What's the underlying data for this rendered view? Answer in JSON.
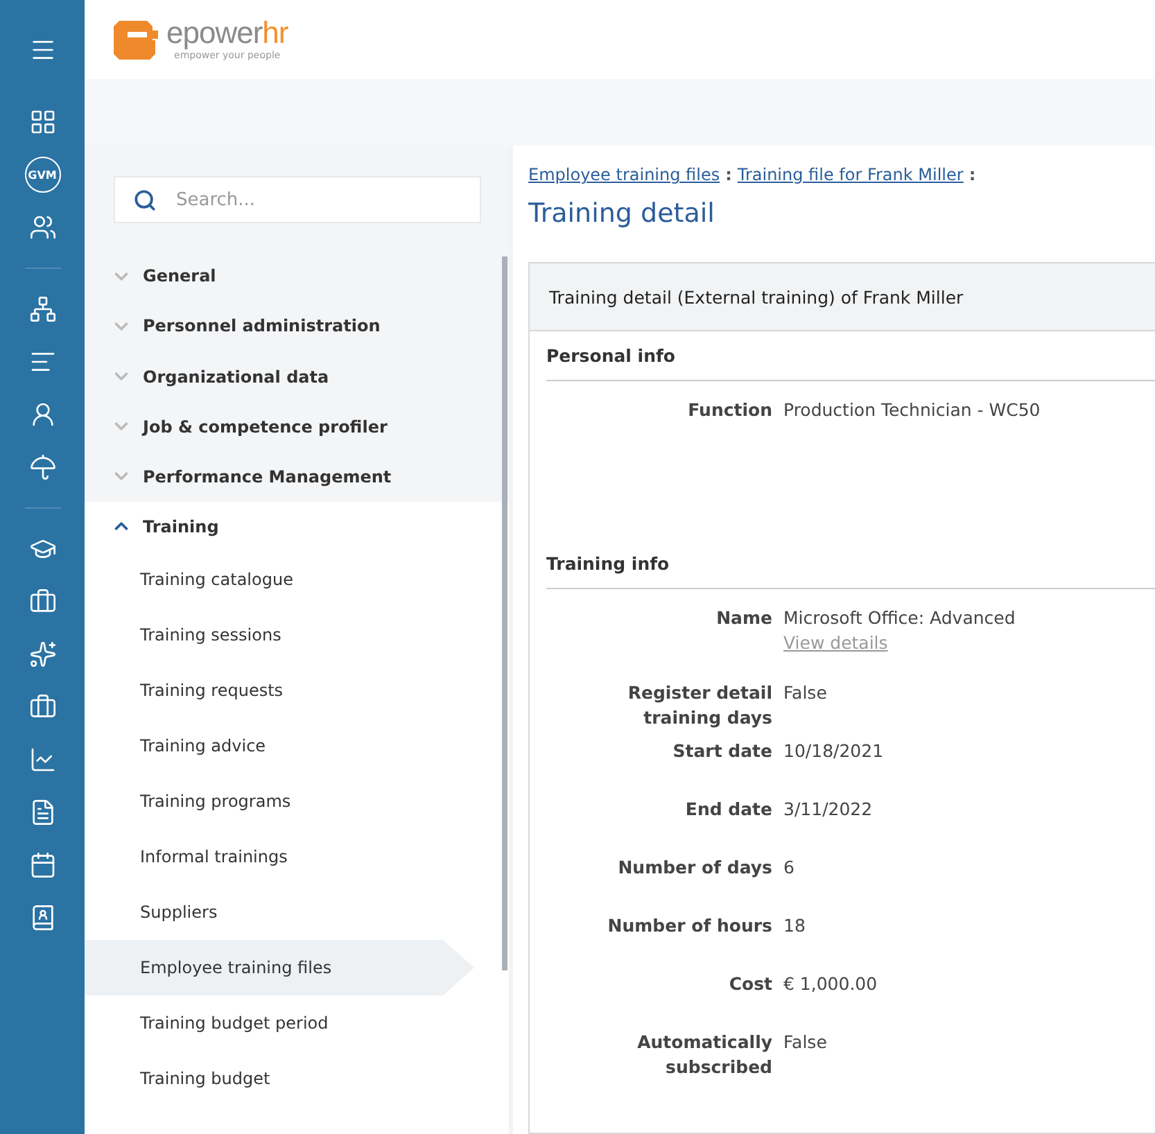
{
  "logo": {
    "name_main": "epower",
    "name_accent": "hr",
    "tagline": "empower your people"
  },
  "rail": {
    "badge": "GVM"
  },
  "search": {
    "placeholder": "Search..."
  },
  "menu": [
    {
      "label": "General",
      "expanded": false
    },
    {
      "label": "Personnel administration",
      "expanded": false
    },
    {
      "label": "Organizational data",
      "expanded": false
    },
    {
      "label": "Job & competence profiler",
      "expanded": false
    },
    {
      "label": "Performance Management",
      "expanded": false
    },
    {
      "label": "Training",
      "expanded": true,
      "children": [
        {
          "label": "Training catalogue",
          "selected": false
        },
        {
          "label": "Training sessions",
          "selected": false
        },
        {
          "label": "Training requests",
          "selected": false
        },
        {
          "label": "Training advice",
          "selected": false
        },
        {
          "label": "Training programs",
          "selected": false
        },
        {
          "label": "Informal trainings",
          "selected": false
        },
        {
          "label": "Suppliers",
          "selected": false
        },
        {
          "label": "Employee training files",
          "selected": true
        },
        {
          "label": "Training budget period",
          "selected": false
        },
        {
          "label": "Training budget",
          "selected": false
        }
      ]
    }
  ],
  "breadcrumb": [
    "Employee training files",
    "Training file for Frank Miller"
  ],
  "breadcrumb_separator": ":",
  "page_title": "Training detail",
  "panel": {
    "title": "Training detail (External training) of Frank Miller",
    "sections": [
      {
        "title": "Personal info",
        "fields": [
          {
            "label": "Function",
            "value": "Production Technician - WC50"
          }
        ]
      },
      {
        "title": "Training info",
        "fields": [
          {
            "label": "Name",
            "value": "Microsoft Office: Advanced",
            "link": "View details"
          },
          {
            "label": "Register detail training days",
            "value": "False"
          },
          {
            "label": "Start date",
            "value": "10/18/2021"
          },
          {
            "label": "End date",
            "value": "3/11/2022"
          },
          {
            "label": "Number of days",
            "value": "6"
          },
          {
            "label": "Number of hours",
            "value": "18"
          },
          {
            "label": "Cost",
            "value": "€ 1,000.00"
          },
          {
            "label": "Automatically subscribed",
            "value": "False"
          }
        ]
      }
    ]
  }
}
